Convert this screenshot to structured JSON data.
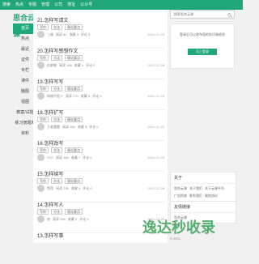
{
  "topnav": [
    "搜索",
    "热点",
    "专题",
    "管理",
    "公司",
    "地址",
    "公众号"
  ],
  "brand": "思合云课",
  "sidebar": [
    "首页",
    "热点",
    "最近",
    "证件",
    "专栏",
    "课件",
    "脑图",
    "视图",
    "教案/试题",
    "练习册题库",
    "资料"
  ],
  "articles": [
    {
      "title": "21.怎样写请文",
      "author": "三顺",
      "views": "阅读 51",
      "likes": "收藏 3",
      "comments": "评论 0",
      "date": "2021-12-28"
    },
    {
      "title": "20.怎样写感想作文",
      "author": "伯爵猫",
      "views": "阅读 168",
      "likes": "收藏 4",
      "comments": "评论 0",
      "date": "2021-12-28"
    },
    {
      "title": "19.怎样写写",
      "author": "网络不是人",
      "views": "阅读 279",
      "likes": "收藏 3",
      "comments": "评论 0",
      "date": "2021-12-28"
    },
    {
      "title": "18.怎样扩写",
      "author": "王者雷霆",
      "views": "阅读 264",
      "likes": "收藏 3",
      "comments": "评论 0",
      "date": "2021-12-28"
    },
    {
      "title": "16.怎样改写",
      "author": "小小",
      "views": "阅读 269",
      "likes": "收藏 7",
      "comments": "评论 0",
      "date": "2021-12-28"
    },
    {
      "title": "15.怎样续写",
      "author": "雪莲",
      "views": "阅读 295",
      "likes": "收藏 4",
      "comments": "评论 0",
      "date": "2021-12-28"
    },
    {
      "title": "14.怎样写人",
      "author": "哈",
      "views": "阅读 256",
      "likes": "收藏 2",
      "comments": "评论 0",
      "date": "2021-12-28"
    },
    {
      "title": "13.怎样写事",
      "author": "",
      "views": "",
      "likes": "",
      "comments": "",
      "date": ""
    }
  ],
  "tags": [
    "写作",
    "方法",
    "理论要点"
  ],
  "search": {
    "placeholder": "搜索思合云课"
  },
  "login": {
    "text": "登录后可以发布您的技巧和经验",
    "button": "马上登录"
  },
  "about": {
    "title": "关于",
    "links": [
      "思合云课",
      "关于我们",
      "关于云课平台",
      "广告投放",
      "联系我们",
      "服务协议",
      "隐私声明",
      "友情链接"
    ]
  },
  "friend": {
    "title": "友情链接",
    "links": [
      "思合云课"
    ]
  },
  "watermark": "逸达秒收录",
  "copyright": "© 2021"
}
